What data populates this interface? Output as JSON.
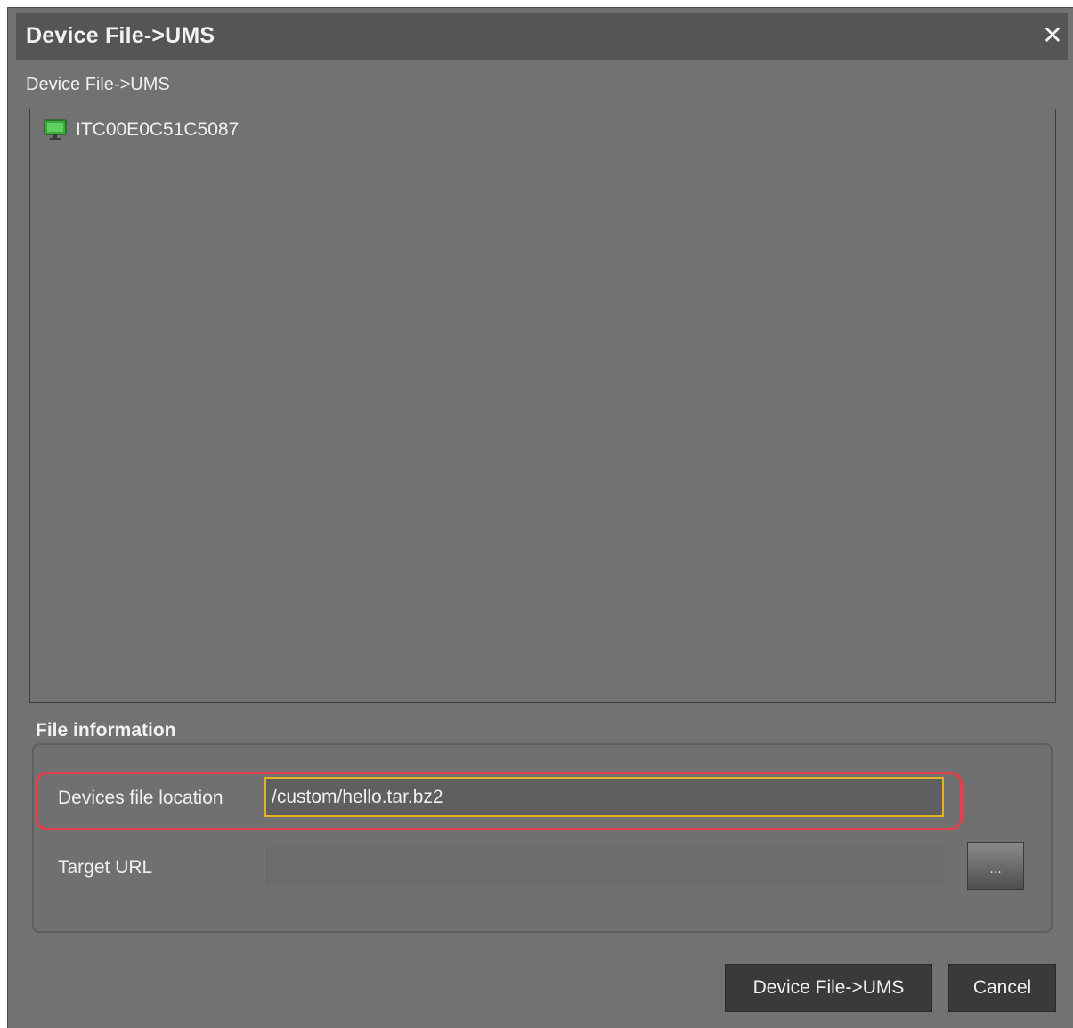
{
  "dialog": {
    "title": "Device File->UMS",
    "close_glyph": "✕",
    "subtitle": "Device File->UMS"
  },
  "devices": [
    {
      "name": "ITC00E0C51C5087",
      "icon": "monitor-icon",
      "icon_color": "#3ea83e"
    }
  ],
  "file_info": {
    "section_label": "File information",
    "location_label": "Devices file location",
    "location_value": "/custom/hello.tar.bz2",
    "target_label": "Target URL",
    "target_value": "",
    "browse_label": "...",
    "highlight_color": "#e0414d",
    "focus_color": "#e0b224"
  },
  "buttons": {
    "confirm_label": "Device File->UMS",
    "cancel_label": "Cancel"
  }
}
